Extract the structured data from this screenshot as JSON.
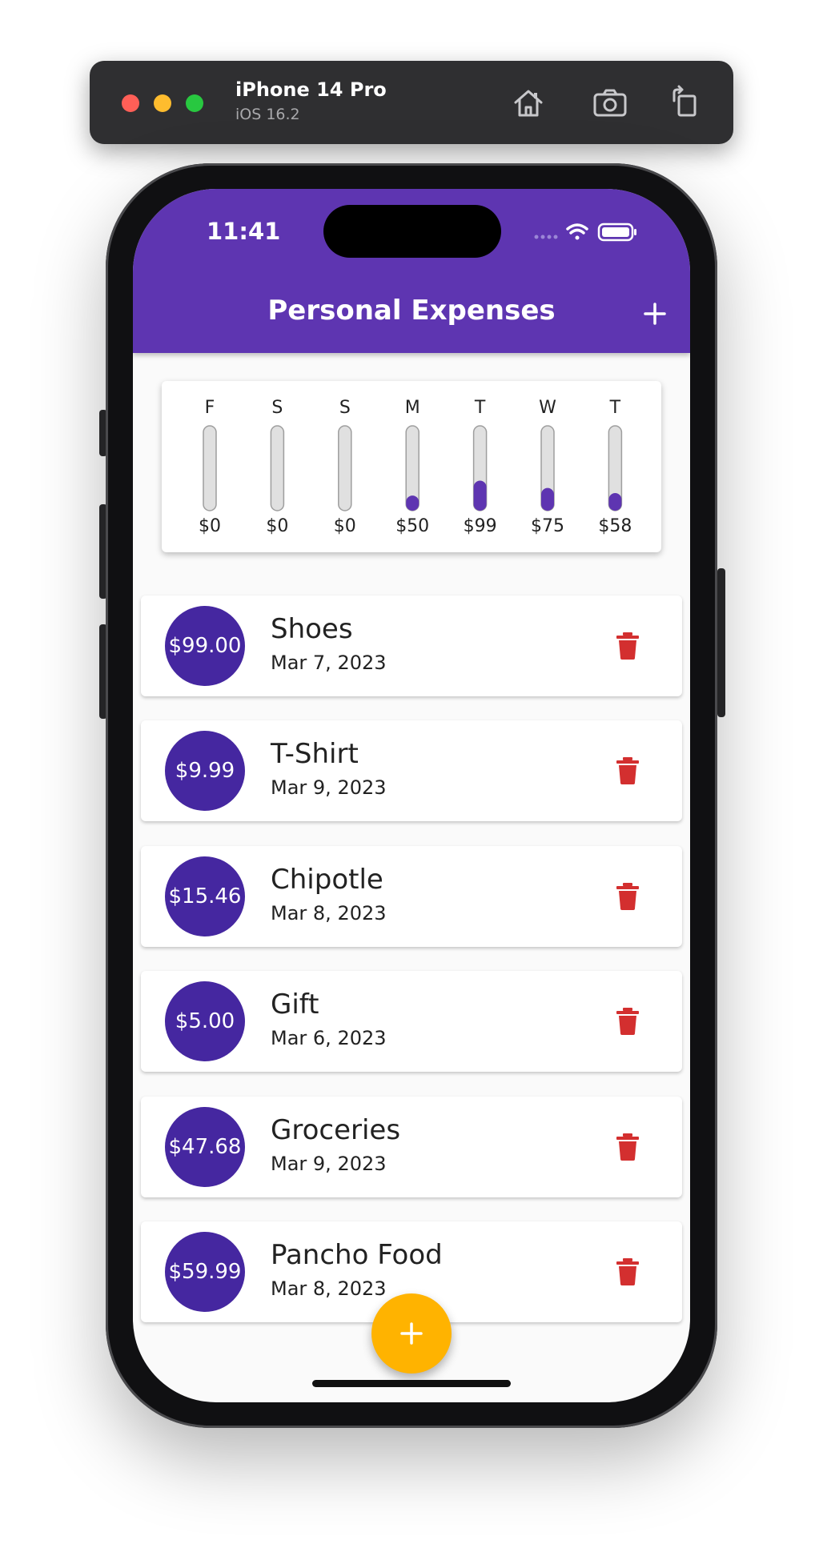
{
  "simulator": {
    "device_name": "iPhone 14 Pro",
    "os_version": "iOS 16.2"
  },
  "status_bar": {
    "time": "11:41"
  },
  "app": {
    "title": "Personal Expenses"
  },
  "colors": {
    "primary": "#5e35b1",
    "avatar": "#4527a0",
    "accent": "#ffb300",
    "delete": "#d32f2f",
    "bar_fill": "#5e35b1",
    "bar_bg": "#e0e0e0"
  },
  "chart_data": {
    "type": "bar",
    "categories": [
      "F",
      "S",
      "S",
      "M",
      "T",
      "W",
      "T"
    ],
    "values": [
      0,
      0,
      0,
      50,
      99,
      75,
      58
    ],
    "value_labels": [
      "$0",
      "$0",
      "$0",
      "$50",
      "$99",
      "$75",
      "$58"
    ],
    "ylim": [
      0,
      280
    ]
  },
  "transactions": [
    {
      "amount": "$99.00",
      "title": "Shoes",
      "date": "Mar 7, 2023"
    },
    {
      "amount": "$9.99",
      "title": "T-Shirt",
      "date": "Mar 9, 2023"
    },
    {
      "amount": "$15.46",
      "title": "Chipotle",
      "date": "Mar 8, 2023"
    },
    {
      "amount": "$5.00",
      "title": "Gift",
      "date": "Mar 6, 2023"
    },
    {
      "amount": "$47.68",
      "title": "Groceries",
      "date": "Mar 9, 2023"
    },
    {
      "amount": "$59.99",
      "title": "Pancho Food",
      "date": "Mar 8, 2023"
    }
  ],
  "icons": {
    "home": "home-icon",
    "screenshot": "camera-icon",
    "rotate": "rotate-icon",
    "add": "plus-icon",
    "delete": "trash-icon"
  }
}
